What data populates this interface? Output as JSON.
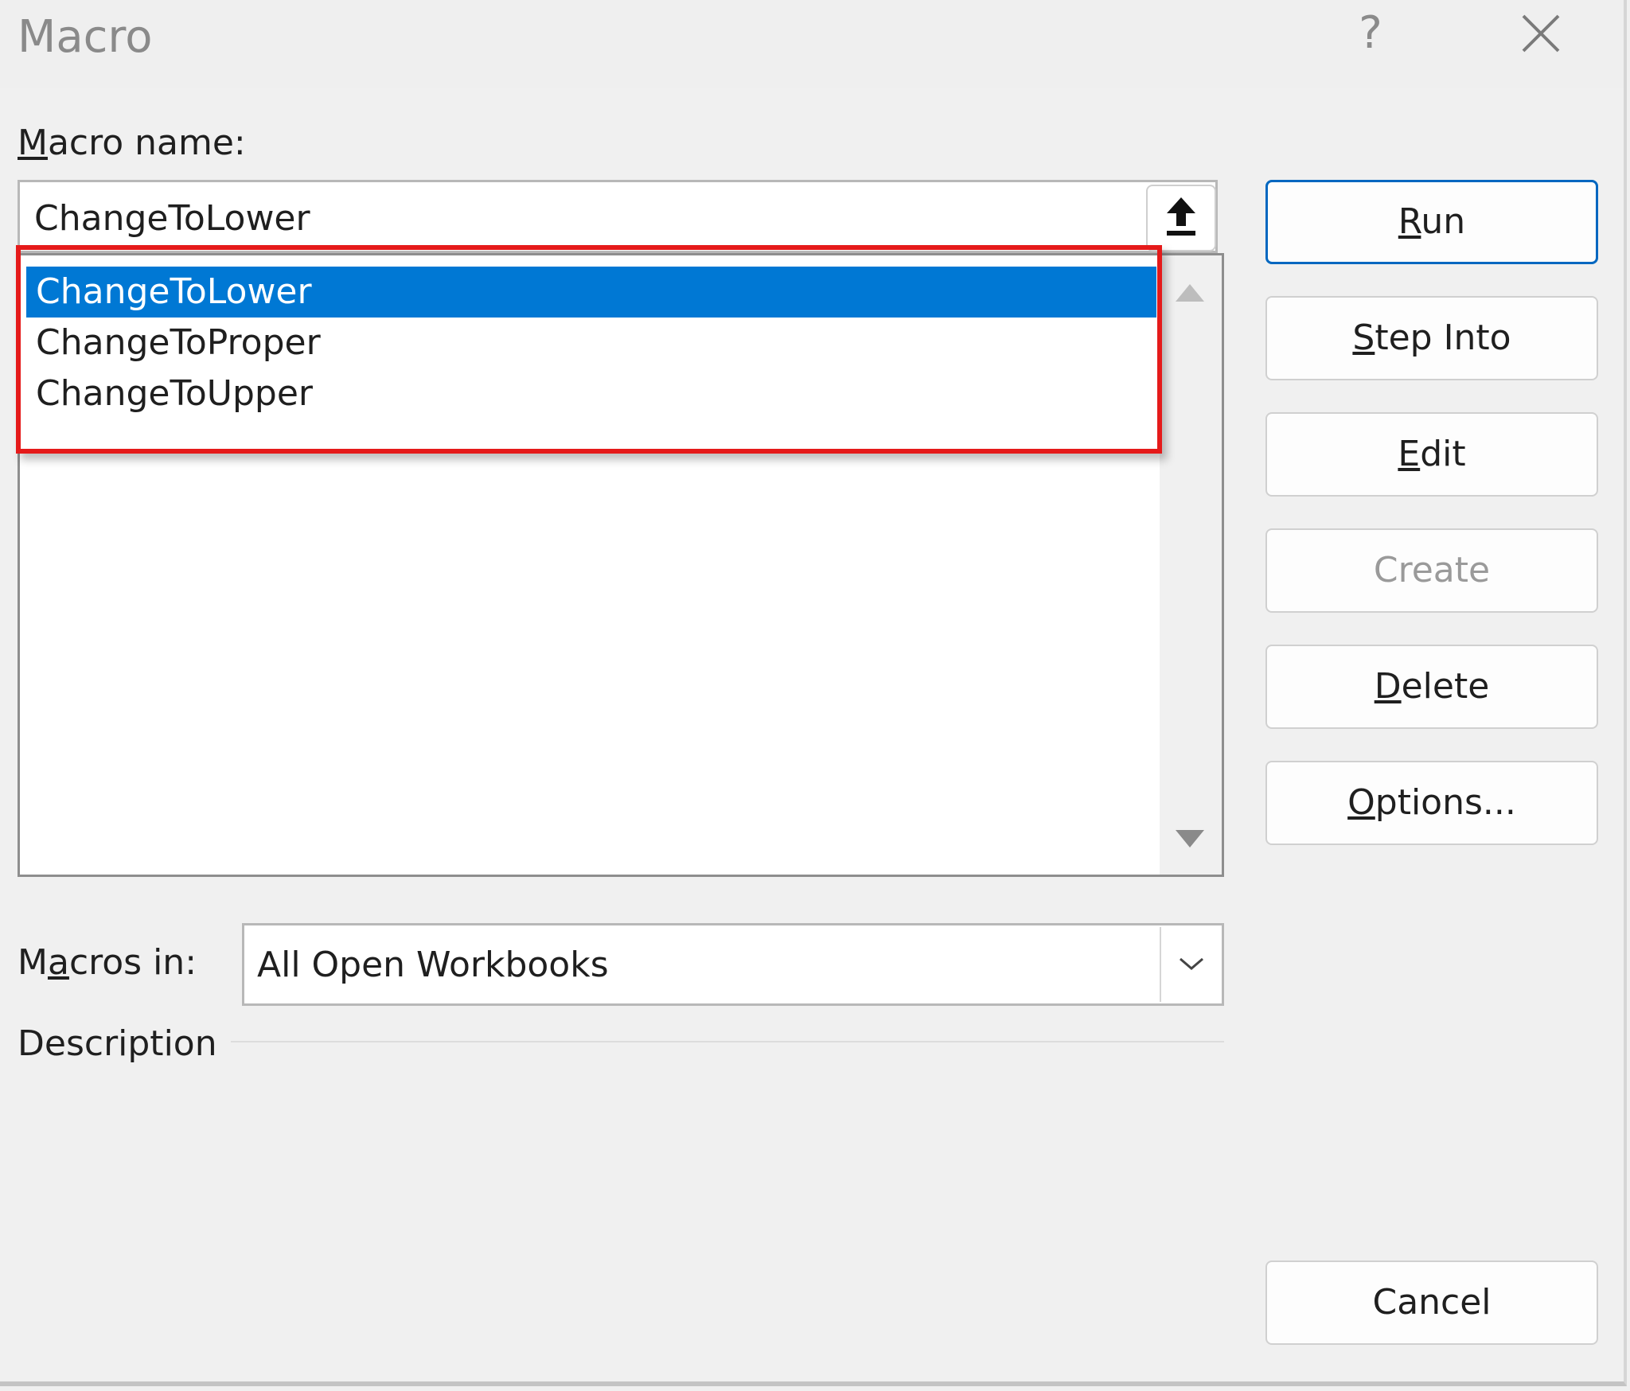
{
  "window": {
    "title": "Macro",
    "help_glyph": "?"
  },
  "macro_name": {
    "label_accel": "M",
    "label_rest": "acro name:",
    "value": "ChangeToLower"
  },
  "macro_list": {
    "items": [
      {
        "label": "ChangeToLower",
        "selected": true
      },
      {
        "label": "ChangeToProper",
        "selected": false
      },
      {
        "label": "ChangeToUpper",
        "selected": false
      }
    ]
  },
  "buttons": {
    "run": {
      "accel": "R",
      "rest": "un",
      "enabled": true,
      "default": true
    },
    "step_into": {
      "accel": "S",
      "rest": "tep Into",
      "enabled": true
    },
    "edit": {
      "accel": "E",
      "rest": "dit",
      "enabled": true
    },
    "create": {
      "label": "Create",
      "enabled": false
    },
    "delete": {
      "accel": "D",
      "rest": "elete",
      "enabled": true
    },
    "options": {
      "accel": "O",
      "rest": "ptions...",
      "enabled": true
    },
    "cancel": {
      "label": "Cancel",
      "enabled": true
    }
  },
  "macros_in": {
    "label_pre": "M",
    "label_accel": "a",
    "label_post": "cros in:",
    "selected": "All Open Workbooks"
  },
  "description": {
    "label": "Description"
  },
  "colors": {
    "selection": "#0078d4",
    "highlight_box": "#e51a1a",
    "default_button_border": "#0067c0"
  }
}
